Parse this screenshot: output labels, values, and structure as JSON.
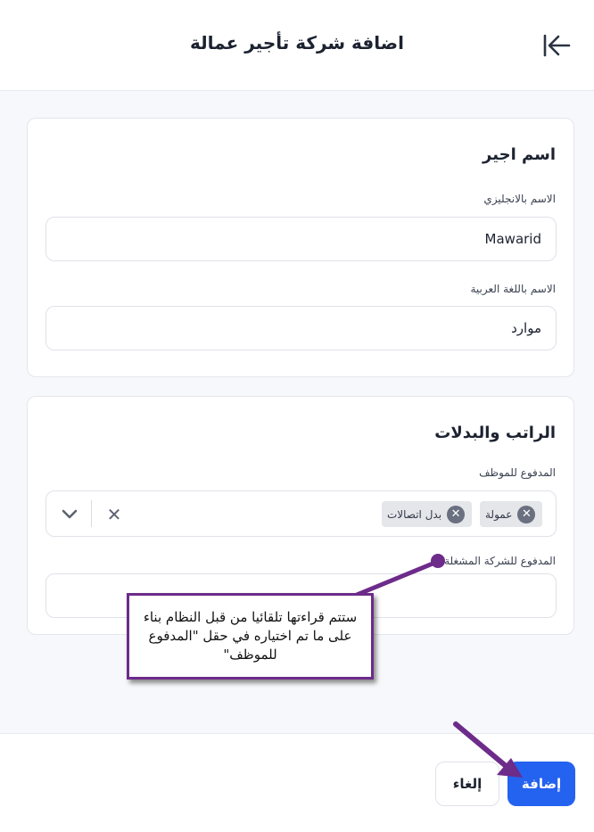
{
  "header": {
    "title": "اضافة شركة تأجير عمالة",
    "back_icon": "arrow-left-to-line-icon"
  },
  "worker_name_section": {
    "title": "اسم اجير",
    "english_name_label": "الاسم بالانجليزي",
    "english_name_value": "Mawarid",
    "arabic_name_label": "الاسم باللغة العربية",
    "arabic_name_value": "موارد"
  },
  "salary_section": {
    "title": "الراتب والبدلات",
    "paid_to_employee_label": "المدفوع للموظف",
    "selected_items": [
      {
        "label": "عمولة"
      },
      {
        "label": "بدل اتصالات"
      }
    ],
    "paid_by_operator_label": "المدفوع للشركة المشغلة",
    "paid_by_operator_value": ""
  },
  "callout": {
    "text": "ستتم قراءتها تلقائيا من قبل النظام بناء على ما تم اختياره في حقل \"المدفوع للموظف\"",
    "color": "#6d2b8a"
  },
  "footer": {
    "add_label": "إضافة",
    "cancel_label": "إلغاء"
  },
  "colors": {
    "primary": "#2462f0",
    "annotation": "#6d2b8a"
  }
}
